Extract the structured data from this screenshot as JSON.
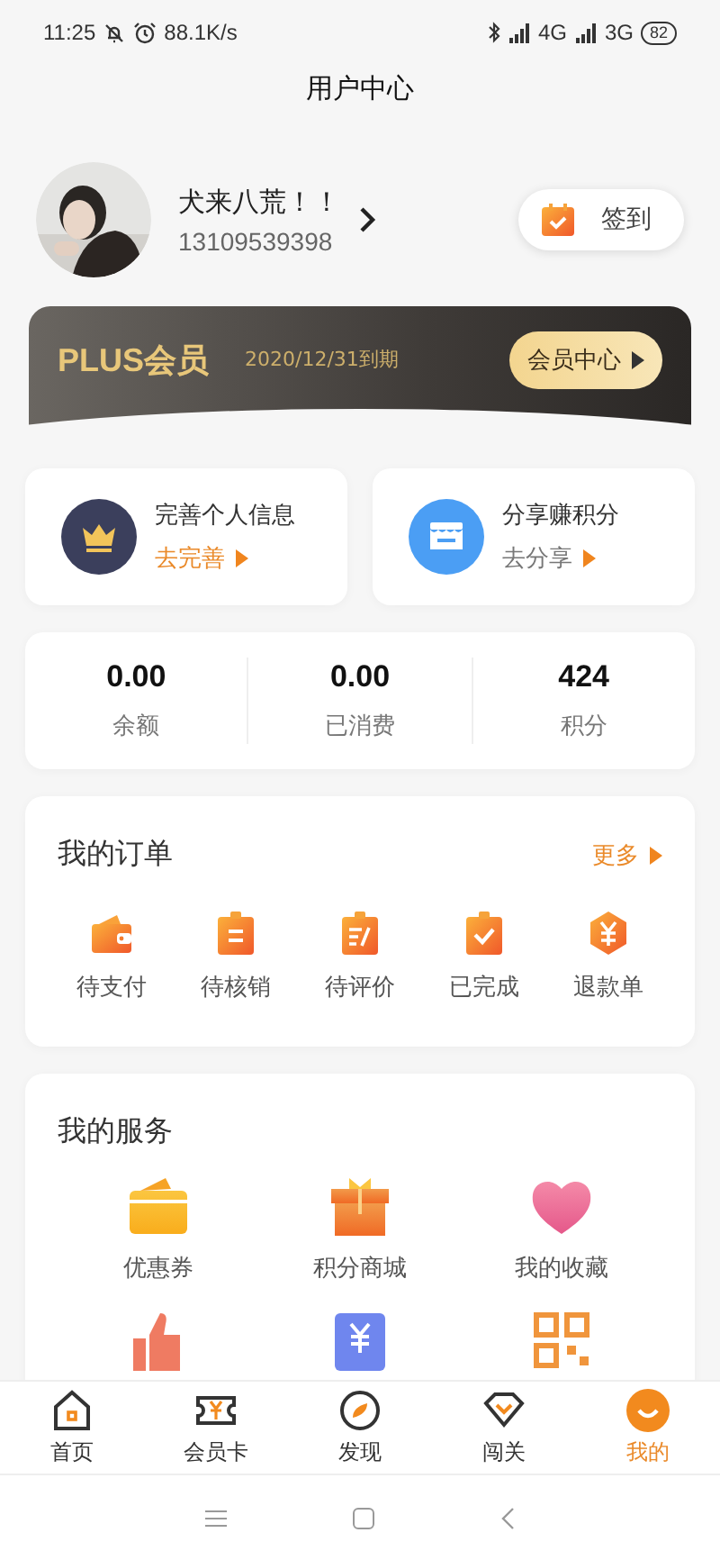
{
  "status_bar": {
    "time": "11:25",
    "speed": "88.1K/s",
    "net1": "4G",
    "net2": "3G",
    "battery": "82"
  },
  "title": "用户中心",
  "profile": {
    "name": "犬来八荒！！",
    "phone": "13109539398",
    "checkin": "签到"
  },
  "plus": {
    "title": "PLUS会员",
    "expiry": "2020/12/31到期",
    "button": "会员中心"
  },
  "tasks": [
    {
      "title": "完善个人信息",
      "action": "去完善",
      "highlight": true
    },
    {
      "title": "分享赚积分",
      "action": "去分享",
      "highlight": false
    }
  ],
  "stats": [
    {
      "value": "0.00",
      "label": "余额"
    },
    {
      "value": "0.00",
      "label": "已消费"
    },
    {
      "value": "424",
      "label": "积分"
    }
  ],
  "orders": {
    "title": "我的订单",
    "more": "更多",
    "items": [
      "待支付",
      "待核销",
      "待评价",
      "已完成",
      "退款单"
    ]
  },
  "services": {
    "title": "我的服务",
    "items": [
      "优惠券",
      "积分商城",
      "我的收藏"
    ]
  },
  "tabs": [
    {
      "label": "首页",
      "selected": false
    },
    {
      "label": "会员卡",
      "selected": false
    },
    {
      "label": "发现",
      "selected": false
    },
    {
      "label": "闯关",
      "selected": false
    },
    {
      "label": "我的",
      "selected": true
    }
  ]
}
